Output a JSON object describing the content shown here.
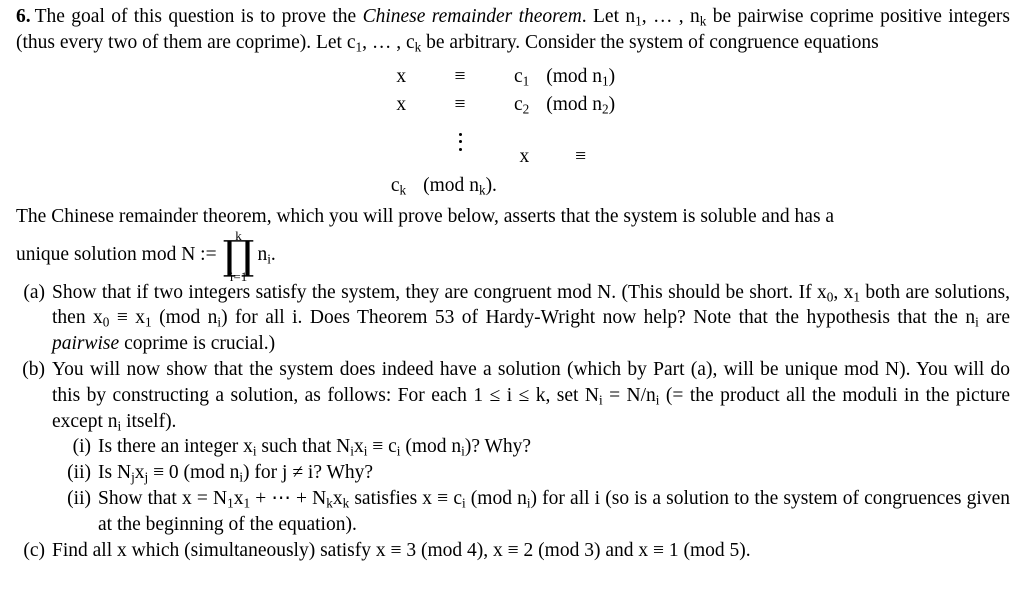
{
  "document": {
    "problem_number": "6.",
    "intro": {
      "seg1": "The goal of this question is to prove the ",
      "italic1": "Chinese remainder theorem",
      "seg2": ". Let ",
      "math1": "n",
      "sub1": "1",
      "seg3": ", … , ",
      "math2": "n",
      "sub2": "k",
      "seg4": " be pairwise coprime positive integers (thus every two of them are coprime). Let ",
      "math3": "c",
      "sub3": "1",
      "seg5": ", … , ",
      "math4": "c",
      "sub4": "k",
      "seg6": " be arbitrary. Consider the system of congruence equations"
    },
    "system": {
      "rows": [
        {
          "x": "x",
          "rel": "≡",
          "c": "c",
          "c_sub": "1",
          "mod_open": "(mod ",
          "n": "n",
          "n_sub": "1",
          "mod_close": ")"
        },
        {
          "x": "x",
          "rel": "≡",
          "c": "c",
          "c_sub": "2",
          "mod_open": "(mod ",
          "n": "n",
          "n_sub": "2",
          "mod_close": ")"
        },
        {
          "x": "x",
          "rel": "≡",
          "c": "c",
          "c_sub": "k",
          "mod_open": "(mod ",
          "n": "n",
          "n_sub": "k",
          "mod_close": ")."
        }
      ],
      "vdots_label": "vertical-ellipsis"
    },
    "assertion": {
      "line": "The Chinese remainder theorem, which you will prove below, asserts that the system is soluble and has a",
      "prod_prefix": "unique solution mod N :=",
      "prod_upper": "k",
      "prod_glyph": "∏",
      "prod_lower": "i=1",
      "prod_operand": "n",
      "prod_operand_sub": "i",
      "prod_suffix": "."
    },
    "parts": [
      {
        "label": "(a)",
        "level": 0,
        "text_html_key": "part_a"
      },
      {
        "label": "(b)",
        "level": 0,
        "text_html_key": "part_b"
      },
      {
        "label": "(i)",
        "level": 1,
        "text_html_key": "part_b_i"
      },
      {
        "label": "(ii)",
        "level": 1,
        "text_html_key": "part_b_ii"
      },
      {
        "label": "(ii)",
        "level": 1,
        "text_html_key": "part_b_iii"
      },
      {
        "label": "(c)",
        "level": 0,
        "text_html_key": "part_c"
      }
    ],
    "part_a": {
      "s1": "Show that if two integers satisfy the system, they are congruent mod N. (This should be short. If ",
      "x0": "x",
      "x0s": "0",
      "s2": ", ",
      "x1": "x",
      "x1s": "1",
      "s3": " both are solutions, then ",
      "x0b": "x",
      "x0bs": "0",
      "s4": " ≡ ",
      "x1b": "x",
      "x1bs": "1",
      "s5": "  (mod ",
      "nb": "n",
      "nbs": "i",
      "s6": ") for all i. Does Theorem 53 of Hardy-Wright now help? Note that the hypothesis that the ",
      "nc": "n",
      "ncs": "i",
      "s7": " are ",
      "ital": "pairwise",
      "s8": " coprime is crucial.)"
    },
    "part_b": {
      "s1": "You will now show that the system does indeed have a solution (which by Part (a), will be unique mod N). You will do this by constructing a solution, as follows: For each 1 ≤ i ≤ k, set ",
      "N": "N",
      "Ns": "i",
      "s2": " = N/",
      "n": "n",
      "ns": "i",
      "s3": " (= the product all the moduli in the picture except ",
      "n2": "n",
      "n2s": "i",
      "s4": " itself)."
    },
    "part_b_i": {
      "s1": "Is there an integer ",
      "x": "x",
      "xs": "i",
      "s2": " such that ",
      "N": "N",
      "Ns": "i",
      "x2": "x",
      "x2s": "i",
      "s3": " ≡ ",
      "c": "c",
      "cs": "i",
      "s4": "  (mod ",
      "n": "n",
      "ns": "i",
      "s5": ")? Why?"
    },
    "part_b_ii": {
      "s1": "Is ",
      "N": "N",
      "Ns": "j",
      "x": "x",
      "xs": "j",
      "s2": " ≡ 0  (mod ",
      "n": "n",
      "ns": "i",
      "s3": ") for j ≠ i? Why?"
    },
    "part_b_iii": {
      "s1": "Show that x = ",
      "N1": "N",
      "N1s": "1",
      "x1": "x",
      "x1s": "1",
      "s2": " + ⋯ + ",
      "Nk": "N",
      "Nks": "k",
      "xk": "x",
      "xks": "k",
      "s3": " satisfies x ≡ ",
      "c": "c",
      "cs": "i",
      "s4": "  (mod ",
      "n": "n",
      "ns": "i",
      "s5": ") for all i (so is a solution to the system of congruences given at the beginning of the equation)."
    },
    "part_c": {
      "s1": "Find all x which (simultaneously) satisfy x ≡ 3  (mod 4), x ≡ 2  (mod 3) and x ≡ 1  (mod 5)."
    }
  }
}
